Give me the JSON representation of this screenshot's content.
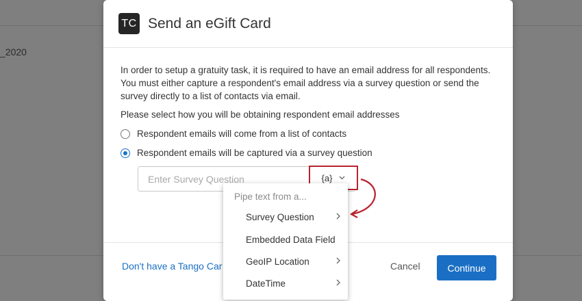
{
  "background": {
    "row_text": "_2020"
  },
  "modal": {
    "logo_text": "TC",
    "title": "Send an eGift Card",
    "description": "In order to setup a gratuity task, it is required to have an email address for all respondents. You must either capture a respondent's email address via a survey question or send the survey directly to a list of contacts via email.",
    "select_label": "Please select how you will be obtaining respondent email addresses",
    "options": [
      {
        "label": "Respondent emails will come from a list of contacts",
        "checked": false
      },
      {
        "label": "Respondent emails will be captured via a survey question",
        "checked": true
      }
    ],
    "question_input": {
      "placeholder": "Enter Survey Question",
      "value": ""
    },
    "pipe_button": {
      "label": "{a}",
      "icon": "chevron-down-icon"
    },
    "footer": {
      "link": "Don't have a Tango Card",
      "cancel": "Cancel",
      "continue": "Continue"
    }
  },
  "pipe_menu": {
    "header": "Pipe text from a...",
    "items": [
      {
        "label": "Survey Question",
        "has_submenu": true
      },
      {
        "label": "Embedded Data Field",
        "has_submenu": false
      },
      {
        "label": "GeoIP Location",
        "has_submenu": true
      },
      {
        "label": "DateTime",
        "has_submenu": true
      }
    ]
  },
  "colors": {
    "accent": "#1a6fc4",
    "highlight": "#b8222e",
    "overlay": "#7f7f7f"
  }
}
